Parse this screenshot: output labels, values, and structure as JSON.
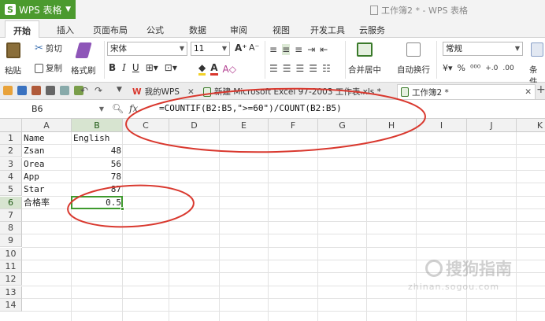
{
  "app": {
    "name": "WPS 表格",
    "window_title": "工作簿2 * - WPS 表格"
  },
  "ribbon_tabs": [
    "开始",
    "插入",
    "页面布局",
    "公式",
    "数据",
    "审阅",
    "视图",
    "开发工具",
    "云服务"
  ],
  "ribbon": {
    "paste": "粘贴",
    "cut": "剪切",
    "copy": "复制",
    "format_painter": "格式刷",
    "font_name": "宋体",
    "font_size": "11",
    "merge_center": "合并居中",
    "wrap_text": "自动换行",
    "number_format": "常规",
    "percent": "%",
    "conditional": "条件"
  },
  "doc_tabs": [
    {
      "label": "我的WPS",
      "active": false
    },
    {
      "label": "新建 Microsoft Excel 97-2003 工作表.xls *",
      "active": false
    },
    {
      "label": "工作簿2 *",
      "active": true
    }
  ],
  "formula_bar": {
    "cell_ref": "B6",
    "fx": "fx",
    "formula": "=COUNTIF(B2:B5,\">=60\")/COUNT(B2:B5)"
  },
  "sheet": {
    "columns": [
      "A",
      "B",
      "C",
      "D",
      "E",
      "F",
      "G",
      "H",
      "I",
      "J",
      "K"
    ],
    "rows": [
      "1",
      "2",
      "3",
      "4",
      "5",
      "6",
      "7",
      "8",
      "9",
      "10",
      "11",
      "12",
      "13",
      "14"
    ],
    "cells": [
      {
        "ref": "A1",
        "value": "Name"
      },
      {
        "ref": "B1",
        "value": "English"
      },
      {
        "ref": "A2",
        "value": "Zsan"
      },
      {
        "ref": "B2",
        "value": "48"
      },
      {
        "ref": "A3",
        "value": "Orea"
      },
      {
        "ref": "B3",
        "value": "56"
      },
      {
        "ref": "A4",
        "value": "App"
      },
      {
        "ref": "B4",
        "value": "78"
      },
      {
        "ref": "A5",
        "value": "Star"
      },
      {
        "ref": "B5",
        "value": "87"
      },
      {
        "ref": "A6",
        "value": "合格率"
      },
      {
        "ref": "B6",
        "value": "0.5"
      }
    ],
    "active_cell": "B6"
  },
  "colors": {
    "accent": "#4b9a2e",
    "annotation": "#d9382e",
    "selection_border": "#3f9a2e"
  },
  "watermark": {
    "main": "搜狗指南",
    "sub": "zhinan.sogou.com"
  }
}
